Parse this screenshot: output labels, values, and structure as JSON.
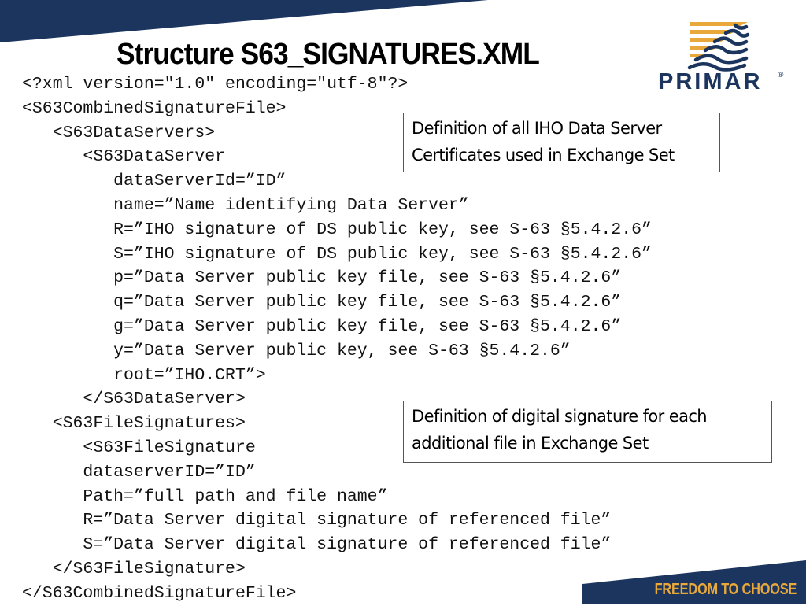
{
  "slide": {
    "title": "Structure S63_SIGNATURES.XML",
    "brand": {
      "name": "PRIMAR",
      "registered_mark": "®",
      "tagline": "FREEDOM TO CHOOSE",
      "colors": {
        "navy": "#1c355e",
        "gold": "#e9a93a",
        "text": "#000000",
        "box_border": "#555555"
      }
    },
    "code_lines": [
      "<?xml version=\"1.0\" encoding=\"utf-8\"?>",
      "<S63CombinedSignatureFile>",
      "   <S63DataServers>",
      "      <S63DataServer",
      "         dataServerId=”ID”",
      "         name=”Name identifying Data Server”",
      "         R=”IHO signature of DS public key, see S-63 §5.4.2.6”",
      "         S=”IHO signature of DS public key, see S-63 §5.4.2.6”",
      "         p=”Data Server public key file, see S-63 §5.4.2.6”",
      "         q=”Data Server public key file, see S-63 §5.4.2.6”",
      "         g=”Data Server public key file, see S-63 §5.4.2.6”",
      "         y=”Data Server public key, see S-63 §5.4.2.6”",
      "         root=”IHO.CRT”>",
      "      </S63DataServer>",
      "   <S63FileSignatures>",
      "      <S63FileSignature",
      "      dataserverID=”ID”",
      "      Path=”full path and file name”",
      "      R=”Data Server digital signature of referenced file”",
      "      S=”Data Server digital signature of referenced file”",
      "   </S63FileSignature>",
      "</S63CombinedSignatureFile>"
    ],
    "callouts": [
      {
        "lines": [
          "Definition of all IHO Data Server",
          "Certificates used in Exchange Set"
        ]
      },
      {
        "lines": [
          "Definition of digital signature for each",
          "additional file in Exchange Set"
        ]
      }
    ]
  }
}
